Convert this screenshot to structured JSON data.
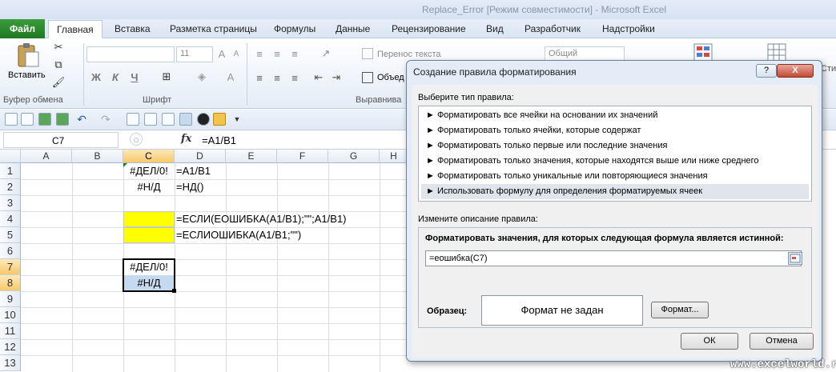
{
  "window": {
    "title": "Replace_Error [Режим совместимости] - Microsoft Excel"
  },
  "tabs": [
    "Файл",
    "Главная",
    "Вставка",
    "Разметка страницы",
    "Формулы",
    "Данные",
    "Рецензирование",
    "Вид",
    "Разработчик",
    "Надстройки"
  ],
  "ribbon": {
    "paste_label": "Вставить",
    "clipboard_group": "Буфер обмена",
    "font_group": "Шрифт",
    "font_size": "11",
    "bold": "Ж",
    "italic": "К",
    "underline": "Ч",
    "wrap_text": "Перенос текста",
    "merge": "Объед",
    "alignment_group": "Выравнива",
    "number_format": "Общий",
    "styles_partial": "Сти"
  },
  "formula_bar": {
    "name_box": "C7",
    "fx": "fx",
    "formula": "=A1/B1"
  },
  "grid": {
    "columns": [
      "A",
      "B",
      "C",
      "D",
      "E",
      "F",
      "G",
      "H"
    ],
    "rows": [
      "1",
      "2",
      "3",
      "4",
      "5",
      "6",
      "7",
      "8",
      "9",
      "10",
      "11",
      "12",
      "13"
    ],
    "cells": {
      "c1": "#ДЕЛ/0!",
      "d1": "=A1/B1",
      "c2": "#Н/Д",
      "d2": "=НД()",
      "d4": "=ЕСЛИ(ЕОШИБКА(A1/B1);\"\";A1/B1)",
      "d5": "=ЕСЛИОШИБКА(A1/B1;\"\")",
      "c7": "#ДЕЛ/0!",
      "c8": "#Н/Д"
    },
    "highlight_color": "#ffff00"
  },
  "dialog": {
    "title": "Создание правила форматирования",
    "help": "?",
    "close": "X",
    "rule_type_label": "Выберите тип правила:",
    "rules": [
      "► Форматировать все ячейки на основании их значений",
      "► Форматировать только ячейки, которые содержат",
      "► Форматировать только первые или последние значения",
      "► Форматировать только значения, которые находятся выше или ниже среднего",
      "► Форматировать только уникальные или повторяющиеся значения",
      "► Использовать формулу для определения форматируемых ячеек"
    ],
    "description_label": "Измените описание правила:",
    "formula_label": "Форматировать значения, для которых следующая формула является истинной:",
    "formula_value": "=еошибка(C7)",
    "sample_label": "Образец:",
    "sample_text": "Формат не задан",
    "format_button": "Формат...",
    "ok_button": "ОК",
    "cancel_button": "Отмена"
  },
  "watermark": "www.excelworld.ru"
}
